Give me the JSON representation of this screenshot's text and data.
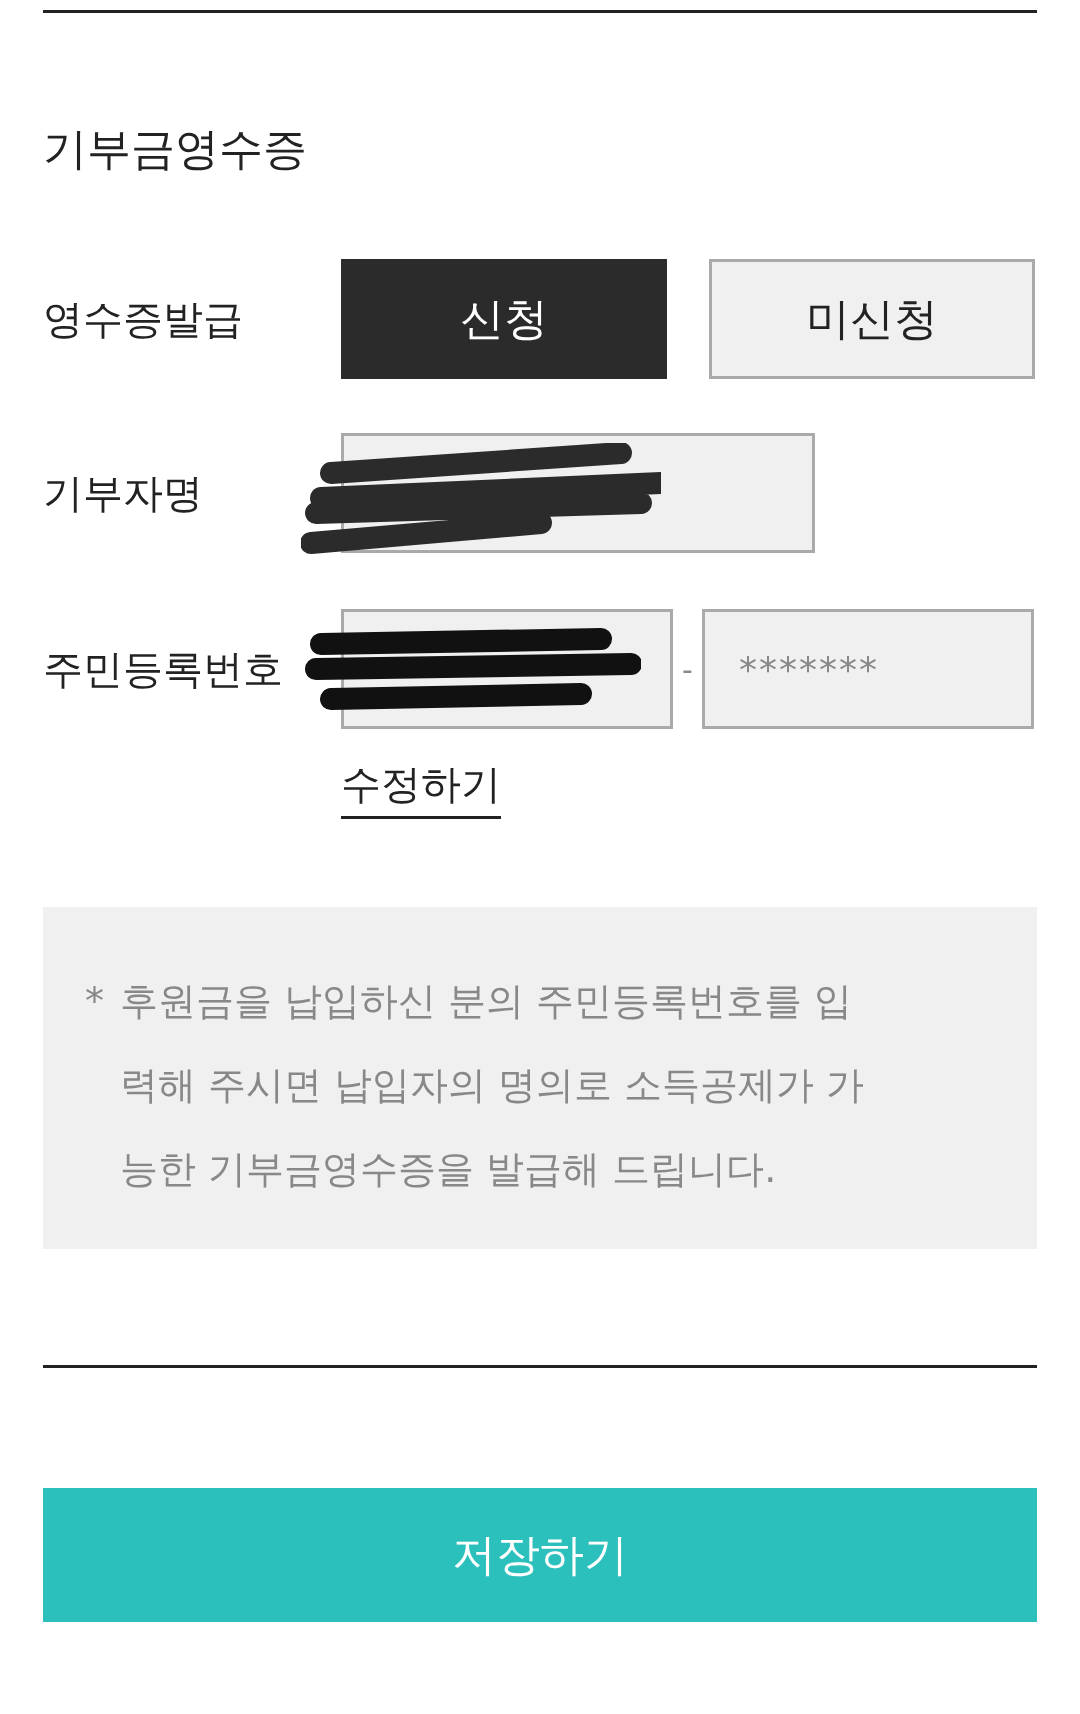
{
  "title": "기부금영수증",
  "receipt": {
    "label": "영수증발급",
    "options": [
      {
        "label": "신청",
        "selected": true
      },
      {
        "label": "미신청",
        "selected": false
      }
    ]
  },
  "donor_name": {
    "label": "기부자명",
    "redacted": true
  },
  "resident_number": {
    "label": "주민등록번호",
    "first_redacted": true,
    "separator": "-",
    "second": "*******"
  },
  "edit_link": "수정하기",
  "notice": {
    "marker": "*",
    "text": "후원금을 납입하신 분의 주민등록번호를 입력해 주시면 납입자의 명의로 소득공제가 가능한 기부금영수증을 발급해 드립니다."
  },
  "save_button": "저장하기"
}
